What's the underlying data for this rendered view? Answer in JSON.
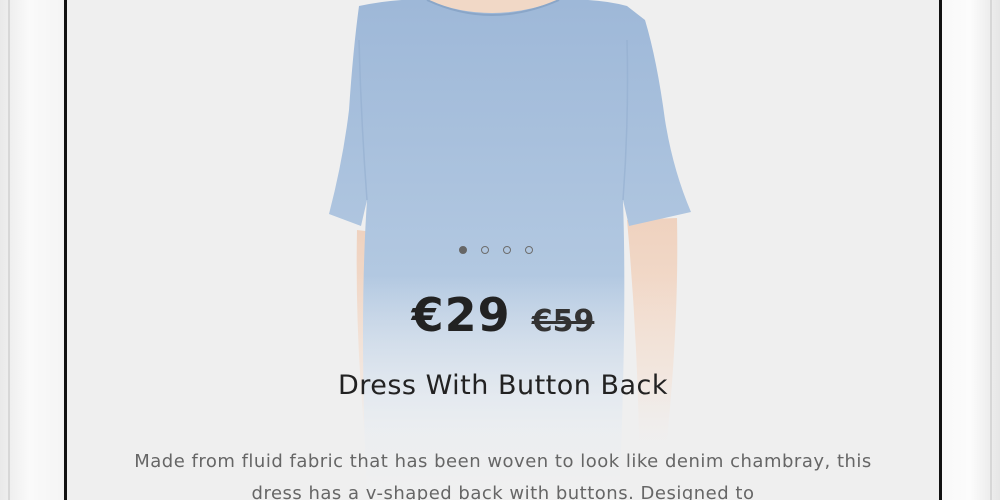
{
  "product": {
    "price_current": "€29",
    "price_old": "€59",
    "title": "Dress With Button Back",
    "description": "Made from fluid fabric that has been woven to look like denim chambray, this dress has a v-shaped back with buttons. Designed to"
  },
  "carousel": {
    "total_slides": 4,
    "active_index": 0
  },
  "colors": {
    "dress": "#a9c1dd",
    "skin": "#f1d8c6",
    "background": "#efefef",
    "frame": "#111111",
    "text_dark": "#222222",
    "text_body": "#666666"
  }
}
